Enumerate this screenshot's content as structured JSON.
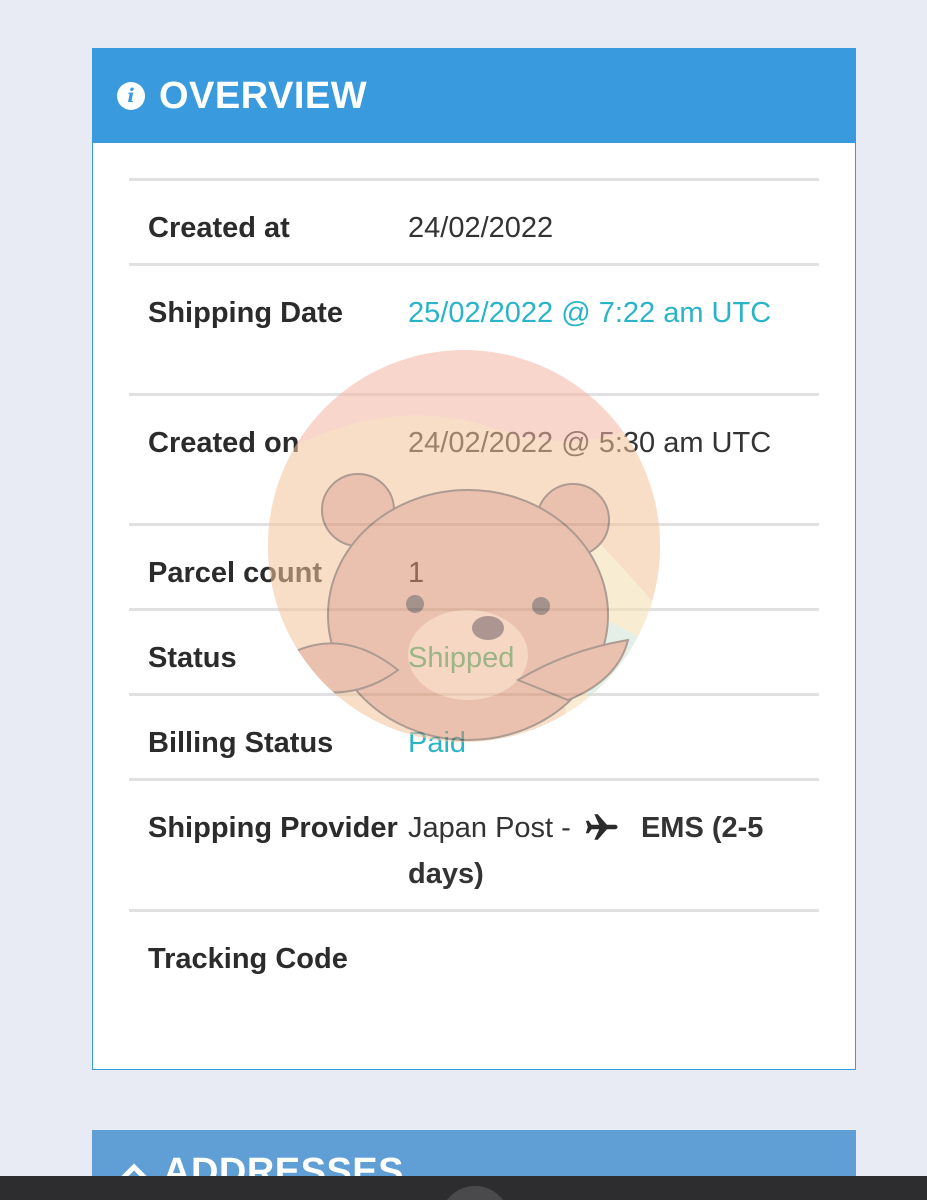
{
  "overview": {
    "title": "OVERVIEW",
    "info_icon_glyph": "i",
    "rows": [
      {
        "label": "Created at",
        "value": "24/02/2022"
      },
      {
        "label": "Shipping Date",
        "value": "25/02/2022 @ 7:22 am UTC"
      },
      {
        "label": "Created on",
        "value": "24/02/2022 @ 5:30 am UTC"
      },
      {
        "label": "Parcel count",
        "value": "1"
      },
      {
        "label": "Status",
        "value": "Shipped"
      },
      {
        "label": "Billing Status",
        "value": "Paid"
      },
      {
        "label": "Shipping Provider",
        "value_prefix": "Japan Post -",
        "value_service": "EMS (2-5 days)"
      },
      {
        "label": "Tracking Code",
        "value": ""
      }
    ]
  },
  "addresses": {
    "title": "ADDRESSES"
  },
  "icons": {
    "info": "info-circle-icon",
    "plane": "plane-icon",
    "chevron": "chevron-up-icon"
  },
  "colors": {
    "header": "#3a9ade",
    "link": "#2ab4c7",
    "status": "#3bb07a",
    "background": "#e8ebf3"
  }
}
